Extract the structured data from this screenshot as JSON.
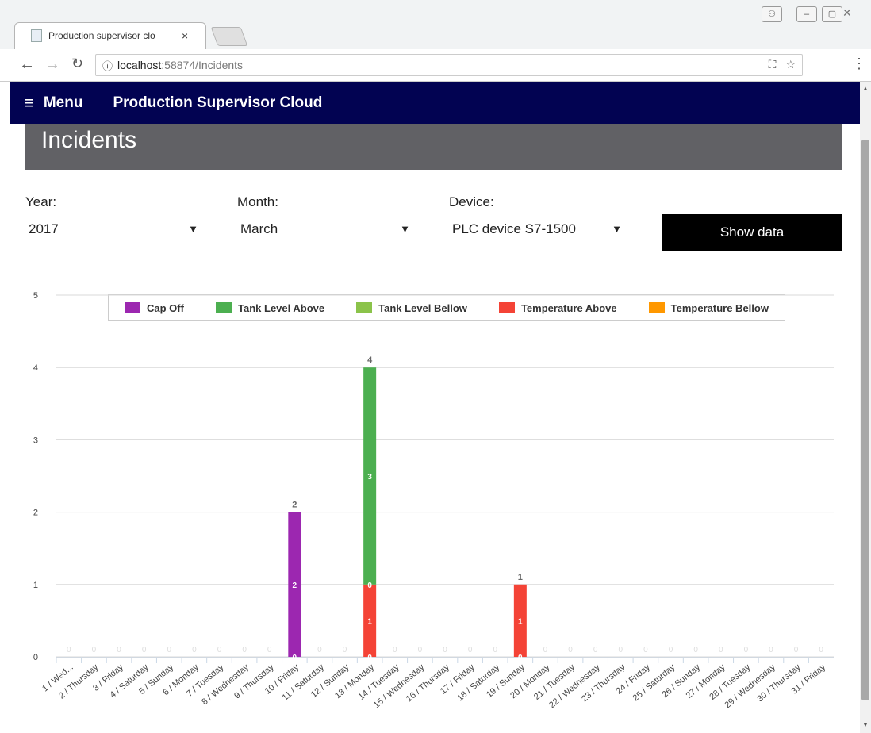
{
  "browser": {
    "tab_title": "Production supervisor clo",
    "tab_close": "×",
    "url_host": "localhost",
    "url_path": ":58874/Incidents",
    "info_icon": "ⓘ"
  },
  "app": {
    "menu_icon": "≡",
    "menu_label": "Menu",
    "title": "Production Supervisor Cloud",
    "page_heading": "Incidents"
  },
  "filters": {
    "year_label": "Year:",
    "year_value": "2017",
    "month_label": "Month:",
    "month_value": "March",
    "device_label": "Device:",
    "device_value": "PLC device S7-1500",
    "dropdown_arrow": "▼",
    "show_button": "Show data"
  },
  "colors": {
    "appbar": "#020352",
    "cap_off": "#9c27b0",
    "tank_level_above": "#4caf50",
    "tank_level_bellow": "#8bc34a",
    "temperature_above": "#f44336",
    "temperature_bellow": "#ff9800"
  },
  "chart_data": {
    "type": "bar",
    "stacked": true,
    "ylim": [
      0,
      5
    ],
    "yticks": [
      0,
      1,
      2,
      3,
      4,
      5
    ],
    "grid": true,
    "legend_position": "top",
    "categories": [
      "1 / Wed...",
      "2 / Thursday",
      "3 / Friday",
      "4 / Saturday",
      "5 / Sunday",
      "6 / Monday",
      "7 / Tuesday",
      "8 / Wednesday",
      "9 / Thursday",
      "10 / Friday",
      "11 / Saturday",
      "12 / Sunday",
      "13 / Monday",
      "14 / Tuesday",
      "15 / Wednesday",
      "16 / Thursday",
      "17 / Friday",
      "18 / Saturday",
      "19 / Sunday",
      "20 / Monday",
      "21 / Tuesday",
      "22 / Wednesday",
      "23 / Thursday",
      "24 / Friday",
      "25 / Saturday",
      "26 / Sunday",
      "27 / Monday",
      "28 / Tuesday",
      "29 / Wednesday",
      "30 / Thursday",
      "31 / Friday"
    ],
    "series": [
      {
        "name": "Cap Off",
        "color": "#9c27b0",
        "values": [
          0,
          0,
          0,
          0,
          0,
          0,
          0,
          0,
          0,
          2,
          0,
          0,
          0,
          0,
          0,
          0,
          0,
          0,
          0,
          0,
          0,
          0,
          0,
          0,
          0,
          0,
          0,
          0,
          0,
          0,
          0
        ]
      },
      {
        "name": "Tank Level Above",
        "color": "#4caf50",
        "values": [
          0,
          0,
          0,
          0,
          0,
          0,
          0,
          0,
          0,
          0,
          0,
          0,
          3,
          0,
          0,
          0,
          0,
          0,
          0,
          0,
          0,
          0,
          0,
          0,
          0,
          0,
          0,
          0,
          0,
          0,
          0
        ]
      },
      {
        "name": "Tank Level Bellow",
        "color": "#8bc34a",
        "values": [
          0,
          0,
          0,
          0,
          0,
          0,
          0,
          0,
          0,
          0,
          0,
          0,
          0,
          0,
          0,
          0,
          0,
          0,
          0,
          0,
          0,
          0,
          0,
          0,
          0,
          0,
          0,
          0,
          0,
          0,
          0
        ]
      },
      {
        "name": "Temperature Above",
        "color": "#f44336",
        "values": [
          0,
          0,
          0,
          0,
          0,
          0,
          0,
          0,
          0,
          0,
          0,
          0,
          1,
          0,
          0,
          0,
          0,
          0,
          1,
          0,
          0,
          0,
          0,
          0,
          0,
          0,
          0,
          0,
          0,
          0,
          0
        ]
      },
      {
        "name": "Temperature Bellow",
        "color": "#ff9800",
        "values": [
          0,
          0,
          0,
          0,
          0,
          0,
          0,
          0,
          0,
          0,
          0,
          0,
          0,
          0,
          0,
          0,
          0,
          0,
          0,
          0,
          0,
          0,
          0,
          0,
          0,
          0,
          0,
          0,
          0,
          0,
          0
        ]
      }
    ],
    "totals": [
      0,
      0,
      0,
      0,
      0,
      0,
      0,
      0,
      0,
      2,
      0,
      0,
      4,
      0,
      0,
      0,
      0,
      0,
      1,
      0,
      0,
      0,
      0,
      0,
      0,
      0,
      0,
      0,
      0,
      0,
      0
    ]
  }
}
